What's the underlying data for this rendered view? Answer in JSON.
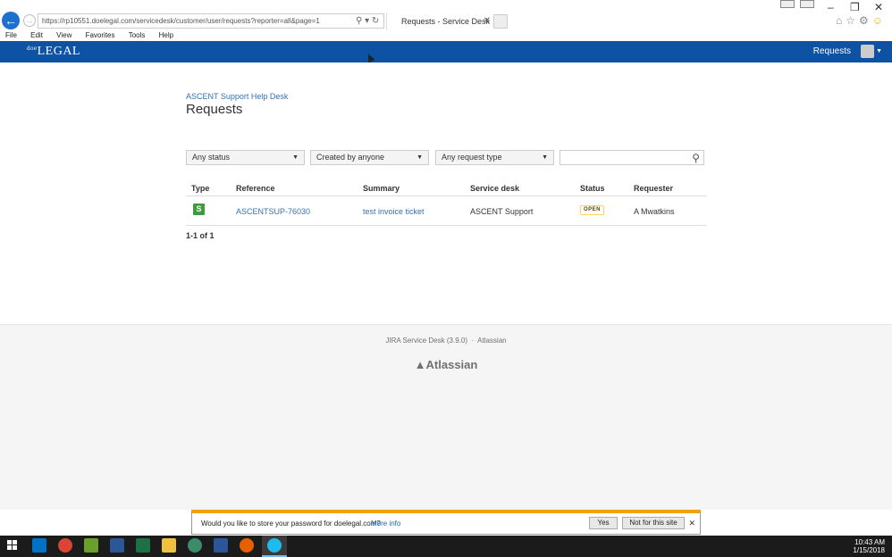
{
  "browser": {
    "url": "https://rp10551.doelegal.com/servicedesk/customer/user/requests?reporter=all&page=1",
    "tab_title": "Requests - Service Desk",
    "menu": [
      "File",
      "Edit",
      "View",
      "Favorites",
      "Tools",
      "Help"
    ]
  },
  "header": {
    "logo_prefix": "doe",
    "logo": "LEGAL",
    "requests_link": "Requests"
  },
  "page": {
    "helpdesk_link": "ASCENT Support Help Desk",
    "title": "Requests"
  },
  "filters": {
    "status": "Any status",
    "created_by": "Created by anyone",
    "request_type": "Any request type",
    "search_value": ""
  },
  "table": {
    "columns": [
      "Type",
      "Reference",
      "Summary",
      "Service desk",
      "Status",
      "Requester"
    ],
    "rows": [
      {
        "type_icon": "S",
        "reference": "ASCENTSUP-76030",
        "summary": "test invoice ticket",
        "service_desk": "ASCENT Support",
        "status": "OPEN",
        "requester": "A Mwatkins"
      }
    ],
    "count": "1-1 of 1"
  },
  "footer": {
    "product": "JIRA Service Desk (3.9.0)",
    "separator": "·",
    "company": "Atlassian",
    "logo": "Atlassian"
  },
  "notification": {
    "message": "Would you like to store your password for doelegal.com?",
    "more_info": "More info",
    "yes": "Yes",
    "not_for_site": "Not for this site"
  },
  "taskbar": {
    "time": "10:43 AM",
    "date": "1/15/2018"
  },
  "colors": {
    "header": "#0d52a3",
    "link": "#3572b0",
    "notif_accent": "#f1a10b"
  }
}
